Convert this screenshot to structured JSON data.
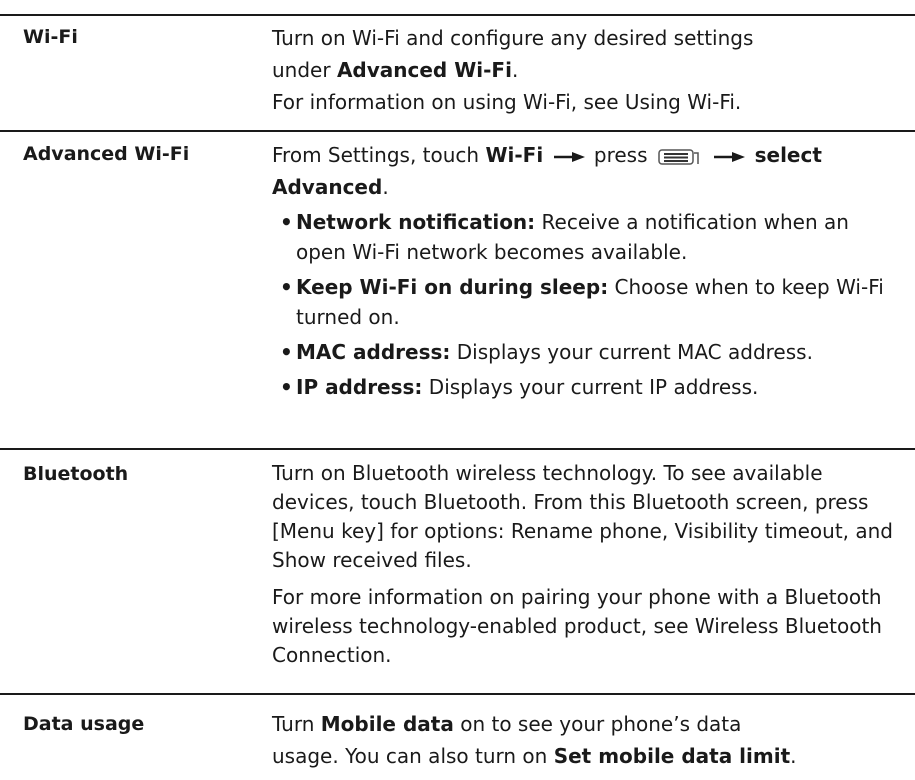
{
  "rows": [
    {
      "term": "Wi-Fi",
      "line1": "Turn on Wi-Fi and configure any desired settings",
      "line2_pre": "under ",
      "line2_bold": "Advanced Wi-Fi",
      "line2_post": ".",
      "line3": "For information on using Wi-Fi, see Using Wi-Fi."
    },
    {
      "term": "Advanced Wi-Fi",
      "intro_pre": "From Settings, touch ",
      "intro_bold1": "Wi-Fi",
      "intro_mid": " press ",
      "intro_bold2": "select",
      "intro_bold3": "Advanced",
      "intro_post": ".",
      "bullets": [
        {
          "label": "Network notification:",
          "text": " Receive a notification when an open Wi-Fi network becomes available."
        },
        {
          "label": "Keep Wi-Fi on during sleep:",
          "text": " Choose when to keep Wi-Fi turned on."
        },
        {
          "label": "MAC address:",
          "text": " Displays your current MAC address."
        },
        {
          "label": "IP address:",
          "text": " Displays your current IP address."
        }
      ]
    },
    {
      "term": "Bluetooth",
      "para1": "Turn on Bluetooth wireless technology. To see available devices, touch Bluetooth. From this Bluetooth screen, press [Menu key] for options: Rename phone, Visibility timeout, and Show received files.",
      "para2": "For more information on pairing your phone with a Bluetooth wireless technology-enabled product, see Wireless Bluetooth Connection."
    },
    {
      "term": "Data usage",
      "line1_pre": "Turn ",
      "line1_bold": "Mobile data",
      "line1_post": " on to see your phone’s data",
      "line2_pre": "usage. You can also turn on ",
      "line2_bold": "Set mobile data limit",
      "line2_post": "."
    }
  ],
  "icons": {
    "arrow": "right-arrow-icon",
    "menu": "menu-key-icon"
  }
}
